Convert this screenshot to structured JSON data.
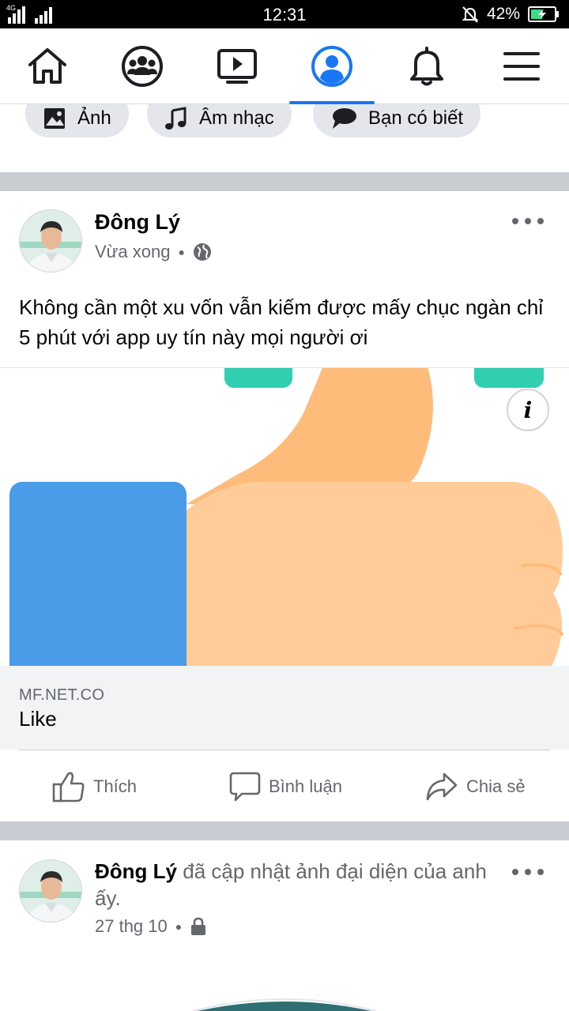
{
  "status_bar": {
    "network": "4G",
    "time": "12:31",
    "battery": "42%"
  },
  "nav": {
    "items": [
      {
        "icon": "home-icon"
      },
      {
        "icon": "groups-icon"
      },
      {
        "icon": "watch-icon"
      },
      {
        "icon": "profile-icon",
        "active": true
      },
      {
        "icon": "bell-icon"
      },
      {
        "icon": "menu-icon"
      }
    ]
  },
  "chips": [
    {
      "label": "Ảnh",
      "icon": "photo-icon"
    },
    {
      "label": "Âm nhạc",
      "icon": "music-icon"
    },
    {
      "label": "Bạn có biết",
      "icon": "speech-bubble-icon"
    }
  ],
  "post1": {
    "author": "Đông Lý",
    "time": "Vừa xong",
    "privacy_icon": "globe-icon",
    "text": "Không cần một xu vốn vẫn kiếm được mấy chục ngàn chỉ 5 phút với app uy tín này mọi người ơi",
    "link": {
      "info_label": "i",
      "domain": "MF.NET.CO",
      "title": "Like"
    },
    "actions": {
      "like": "Thích",
      "comment": "Bình luận",
      "share": "Chia sẻ"
    }
  },
  "post2": {
    "author": "Đông Lý",
    "activity": "đã cập nhật ảnh đại diện của anh ấy.",
    "time": "27 thg 10",
    "privacy_icon": "lock-icon"
  },
  "colors": {
    "accent": "#1877f2",
    "separator": "#c9ccd1",
    "secondary_text": "#65676b",
    "thumb_skin": "#ffcc99",
    "thumb_shade": "#ffbb7a",
    "cuff_blue": "#4a9be8",
    "teal": "#2fcfb0"
  }
}
